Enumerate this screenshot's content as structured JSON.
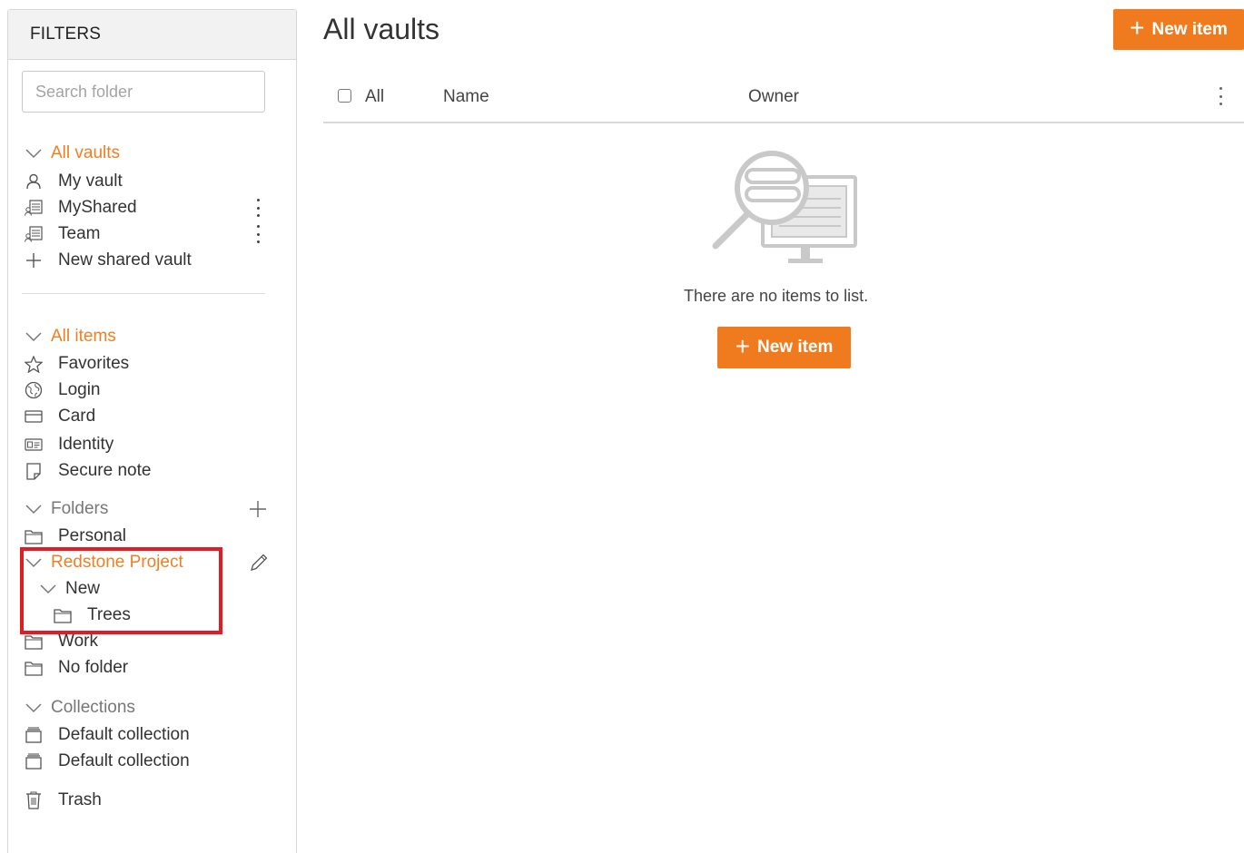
{
  "sidebar": {
    "header": "FILTERS",
    "search_placeholder": "Search folder",
    "vaults": {
      "label": "All vaults",
      "items": [
        {
          "label": "My vault",
          "icon": "user-icon"
        },
        {
          "label": "MyShared",
          "icon": "shared-vault-icon"
        },
        {
          "label": "Team",
          "icon": "shared-vault-icon"
        },
        {
          "label": "New shared vault",
          "icon": "plus-icon"
        }
      ]
    },
    "types": {
      "label": "All items",
      "items": [
        {
          "label": "Favorites",
          "icon": "star-icon"
        },
        {
          "label": "Login",
          "icon": "globe-icon"
        },
        {
          "label": "Card",
          "icon": "credit-card-icon"
        },
        {
          "label": "Identity",
          "icon": "id-card-icon"
        },
        {
          "label": "Secure note",
          "icon": "note-icon"
        }
      ]
    },
    "folders": {
      "label": "Folders",
      "personal": "Personal",
      "project": "Redstone Project",
      "sub": "New",
      "subsub": "Trees",
      "work": "Work",
      "none": "No folder"
    },
    "collections": {
      "label": "Collections",
      "items": [
        "Default collection",
        "Default collection"
      ]
    },
    "trash": "Trash"
  },
  "main": {
    "title": "All vaults",
    "new_item_label": "New item",
    "columns": {
      "all": "All",
      "name": "Name",
      "owner": "Owner"
    },
    "empty_text": "There are no items to list.",
    "empty_button": "New item"
  },
  "colors": {
    "accent": "#f07b1f",
    "highlight": "#e31b23"
  }
}
